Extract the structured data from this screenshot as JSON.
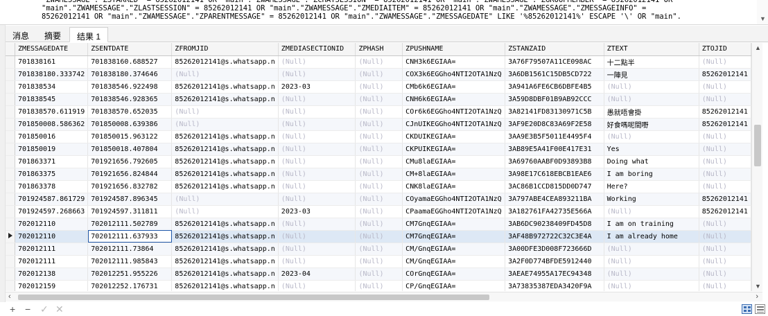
{
  "sql": {
    "lines": [
      "\"ZWAMESSAGE\".\"ZSTARRED\" = 85262012141 OR \"main\".\"ZWAMESSAGE\".\"ZCHATSESSION\" = 85262012141 OR \"main\".\"ZWAMESSAGE\".\"ZGROUPMEMBER\" = 85262012141 OR",
      "\"main\".\"ZWAMESSAGE\".\"ZLASTSESSION\" = 85262012141 OR \"main\".\"ZWAMESSAGE\".\"ZMEDIAITEM\" = 85262012141 OR \"main\".\"ZWAMESSAGE\".\"ZMESSAGEINFO\" =",
      "85262012141 OR \"main\".\"ZWAMESSAGE\".\"ZPARENTMESSAGE\" = 85262012141 OR \"main\".\"ZWAMESSAGE\".\"ZMESSAGEDATE\" LIKE '%85262012141%' ESCAPE '\\' OR \"main\"."
    ]
  },
  "tabs": [
    {
      "label": "消息"
    },
    {
      "label": "摘要"
    },
    {
      "label": "结果 1"
    }
  ],
  "grid": {
    "columns": [
      "ZMESSAGEDATE",
      "ZSENTDATE",
      "ZFROMJID",
      "ZMEDIASECTIONID",
      "ZPHASH",
      "ZPUSHNAME",
      "ZSTANZAID",
      "ZTEXT",
      "ZTOJID"
    ],
    "null_text": "(Null)",
    "rows": [
      [
        "701838161",
        "701838160.688527",
        "85262012141@s.whatsapp.n",
        null,
        null,
        "CNH3k6EGIAA=",
        "3A76F79507A11CE098AC",
        "十二點半",
        null
      ],
      [
        "701838180.333742",
        "701838180.374646",
        null,
        null,
        null,
        "COX3k6EGGho4NTI2OTA1NzQ",
        "3A6DB1561C15DB5CD722",
        "一陣見",
        "85262012141"
      ],
      [
        "701838534",
        "701838546.922498",
        "85262012141@s.whatsapp.n",
        "2023-03",
        null,
        "CMb6k6EGIAA=",
        "3A941A6FE6CB6DBFE4B5",
        null,
        null
      ],
      [
        "701838545",
        "701838546.928365",
        "85262012141@s.whatsapp.n",
        null,
        null,
        "CNH6k6EGIAA=",
        "3A59D8DBF01B9AB92CCC",
        null,
        null
      ],
      [
        "701838570.611919",
        "701838570.652035",
        null,
        null,
        null,
        "COr6k6EGGho4NTI2OTA1NzQ",
        "3A82141FD83130971C5B",
        "愚就唔會掛",
        "85262012141"
      ],
      [
        "701850008.586362",
        "701850008.639386",
        null,
        null,
        null,
        "CJnUIKEGGho4NTI2OTA1NzQ",
        "3AF9E20D8C83A69F2E58",
        "好食嗎呢間嘢",
        "85262012141"
      ],
      [
        "701850016",
        "701850015.963122",
        "85262012141@s.whatsapp.n",
        null,
        null,
        "CKDUIKEGIAA=",
        "3AA9E3B5F5011E4495F4",
        null,
        null
      ],
      [
        "701850019",
        "701850018.407804",
        "85262012141@s.whatsapp.n",
        null,
        null,
        "CKPUIKEGIAA=",
        "3AB89E5A41F00E417E31",
        "Yes",
        null
      ],
      [
        "701863371",
        "701921656.792605",
        "85262012141@s.whatsapp.n",
        null,
        null,
        "CMu8laEGIAA=",
        "3A69760AABF0D93893B8",
        "Doing what",
        null
      ],
      [
        "701863375",
        "701921656.824844",
        "85262012141@s.whatsapp.n",
        null,
        null,
        "CM+8laEGIAA=",
        "3A98E17C618EBCB1EAE6",
        "I am boring",
        null
      ],
      [
        "701863378",
        "701921656.832782",
        "85262012141@s.whatsapp.n",
        null,
        null,
        "CNK8laEGIAA=",
        "3AC86B1CCD815DD0D747",
        "Here?",
        null
      ],
      [
        "701924587.861729",
        "701924587.896345",
        null,
        null,
        null,
        "COyamaEGGho4NTI2OTA1NzQ",
        "3A797ABE4CEA893211BA",
        "Working",
        "85262012141"
      ],
      [
        "701924597.268663",
        "701924597.311811",
        null,
        "2023-03",
        null,
        "CPaamaEGGho4NTI2OTA1NzQ",
        "3A182761FA42735E566A",
        null,
        "85262012141"
      ],
      [
        "702012110",
        "702012111.502789",
        "85262012141@s.whatsapp.n",
        null,
        null,
        "CM7GnqEGIAA=",
        "3AB6DC90238409FD45D8",
        "I am on training",
        null
      ],
      [
        "702012110",
        "702012111.637933",
        "85262012141@s.whatsapp.n",
        null,
        null,
        "CM7GnqEGIAA=",
        "3AF48B972722C32C3E4A",
        "I am already home",
        null
      ],
      [
        "702012111",
        "702012111.73864",
        "85262012141@s.whatsapp.n",
        null,
        null,
        "CM/GnqEGIAA=",
        "3A00DFE3D008F723666D",
        null,
        null
      ],
      [
        "702012111",
        "702012111.985843",
        "85262012141@s.whatsapp.n",
        null,
        null,
        "CM/GnqEGIAA=",
        "3A2F0D774BFDE5912440",
        null,
        null
      ],
      [
        "702012138",
        "702012251.955226",
        "85262012141@s.whatsapp.n",
        "2023-04",
        null,
        "COrGnqEGIAA=",
        "3AEAE74955A17EC94348",
        null,
        null
      ],
      [
        "702012159",
        "702012252.176731",
        "85262012141@s.whatsapp.n",
        null,
        null,
        "CP/GnqEGIAA=",
        "3A73835387EDA3420F9A",
        null,
        null
      ]
    ],
    "selected_row": 14,
    "focused_col": 1
  },
  "toolbar": {
    "add": "+",
    "remove": "−",
    "apply": "✓",
    "cancel": "✕"
  },
  "colors": {
    "selection": "#dde8f5",
    "focus_border": "#1e56a8",
    "null_text": "#b8b8c8"
  }
}
